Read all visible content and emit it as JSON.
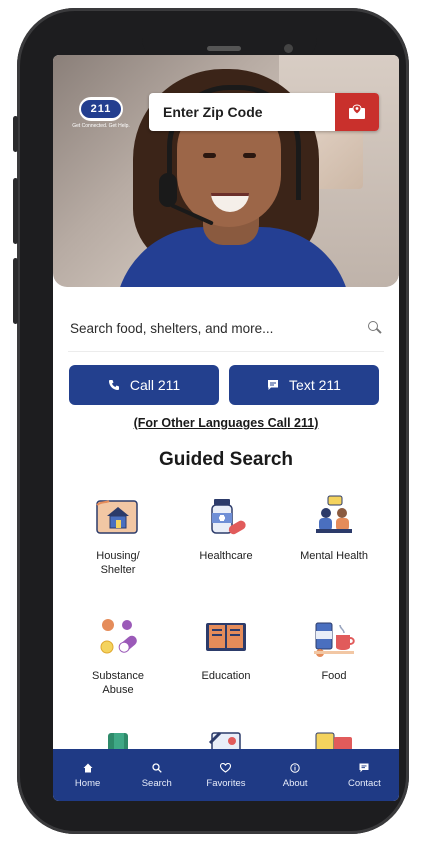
{
  "header": {
    "logo_text": "211",
    "logo_subtitle": "Get Connected. Get Help.",
    "zip_placeholder": "Enter Zip Code",
    "zip_button_icon": "map-pin-icon"
  },
  "search": {
    "placeholder": "Search food, shelters, and more..."
  },
  "actions": {
    "call_label": "Call 211",
    "text_label": "Text 211",
    "languages_note": "(For Other Languages Call 211)"
  },
  "guided": {
    "title": "Guided Search",
    "categories": [
      {
        "label": "Housing/\nShelter",
        "icon": "house-icon"
      },
      {
        "label": "Healthcare",
        "icon": "medicine-icon"
      },
      {
        "label": "Mental Health",
        "icon": "counseling-icon"
      },
      {
        "label": "Substance\nAbuse",
        "icon": "pills-icon"
      },
      {
        "label": "Education",
        "icon": "book-icon"
      },
      {
        "label": "Food",
        "icon": "food-icon"
      }
    ]
  },
  "nav": {
    "items": [
      {
        "label": "Home",
        "icon": "home-icon"
      },
      {
        "label": "Search",
        "icon": "search-icon"
      },
      {
        "label": "Favorites",
        "icon": "heart-icon"
      },
      {
        "label": "About",
        "icon": "info-icon"
      },
      {
        "label": "Contact",
        "icon": "chat-icon"
      }
    ]
  },
  "colors": {
    "brand_blue": "#23408e",
    "nav_blue": "#1f3a85",
    "alert_red": "#c9302c"
  }
}
